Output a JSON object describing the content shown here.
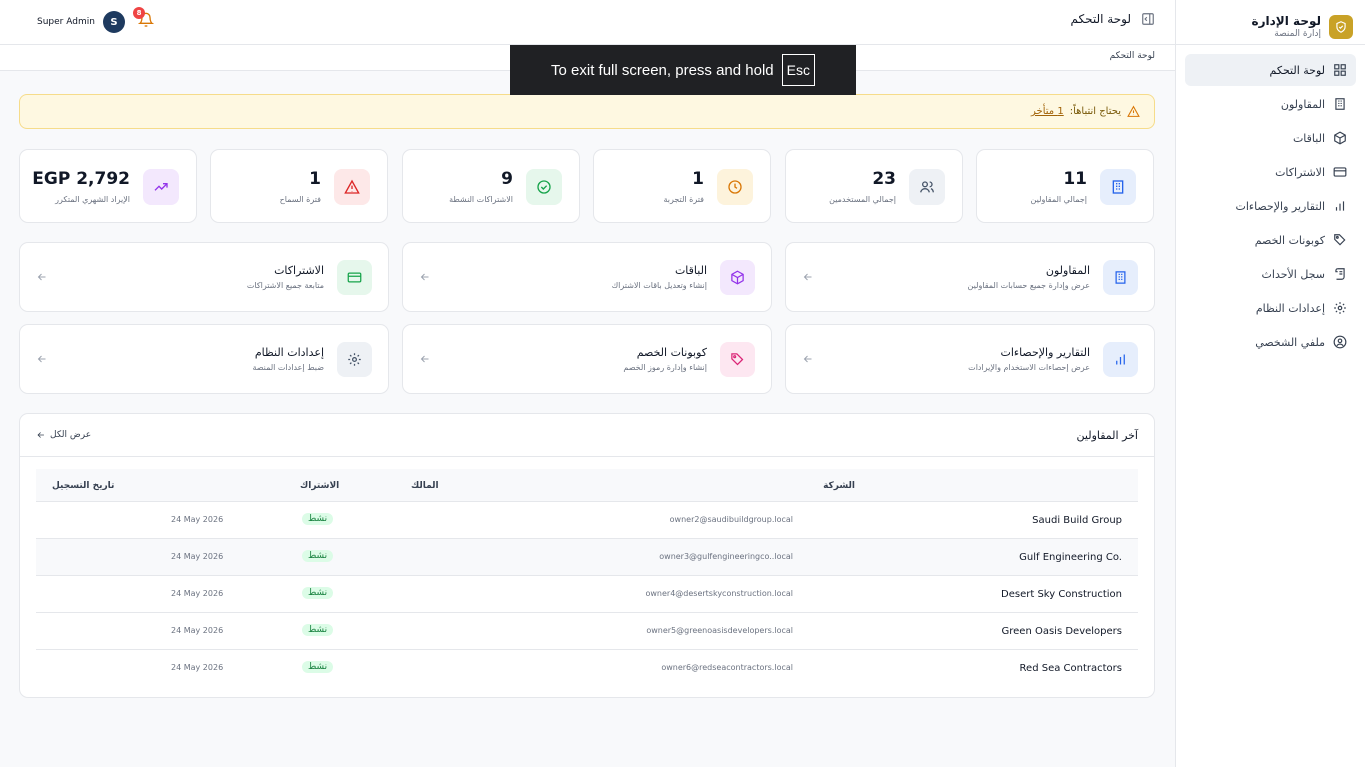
{
  "sidebar": {
    "title": "لوحة الإدارة",
    "subtitle": "إدارة المنصة",
    "items": [
      {
        "label": "لوحة التحكم",
        "icon": "dashboard-icon",
        "active": true
      },
      {
        "label": "المقاولون",
        "icon": "building-icon"
      },
      {
        "label": "الباقات",
        "icon": "package-icon"
      },
      {
        "label": "الاشتراكات",
        "icon": "credit-card-icon"
      },
      {
        "label": "التقارير والإحصاءات",
        "icon": "bar-chart-icon"
      },
      {
        "label": "كوبونات الخصم",
        "icon": "tag-icon"
      },
      {
        "label": "سجل الأحداث",
        "icon": "scroll-icon"
      },
      {
        "label": "إعدادات النظام",
        "icon": "gear-icon"
      },
      {
        "label": "ملفي الشخصي",
        "icon": "user-circle-icon"
      }
    ]
  },
  "topbar": {
    "title": "لوحة التحكم",
    "user_name": "Super Admin",
    "avatar_letter": "S",
    "notification_count": "8"
  },
  "breadcrumb": "لوحة التحكم",
  "fullscreen_toast": {
    "text": "To exit full screen, press and hold",
    "key": "Esc"
  },
  "alert": {
    "text": "يحتاج انتباهاً:",
    "link": "1 متأخر"
  },
  "stats": [
    {
      "value": "11",
      "label": "إجمالي المقاولين",
      "icon": "building-icon",
      "color": "#2563eb"
    },
    {
      "value": "23",
      "label": "إجمالي المستخدمين",
      "icon": "users-icon",
      "color": "#475569"
    },
    {
      "value": "1",
      "label": "فترة التجربة",
      "icon": "clock-icon",
      "color": "#d97706"
    },
    {
      "value": "9",
      "label": "الاشتراكات النشطة",
      "icon": "check-circle-icon",
      "color": "#16a34a"
    },
    {
      "value": "1",
      "label": "فترة السماح",
      "icon": "warning-icon",
      "color": "#dc2626"
    },
    {
      "value": "EGP 2,792",
      "label": "الإيراد الشهري المتكرر",
      "icon": "trending-up-icon",
      "color": "#9333ea"
    }
  ],
  "quick_links": [
    {
      "title": "المقاولون",
      "sub": "عرض وإدارة جميع حسابات المقاولين",
      "icon": "building-icon",
      "color": "#2563eb"
    },
    {
      "title": "الباقات",
      "sub": "إنشاء وتعديل باقات الاشتراك",
      "icon": "package-icon",
      "color": "#9333ea"
    },
    {
      "title": "الاشتراكات",
      "sub": "متابعة جميع الاشتراكات",
      "icon": "credit-card-icon",
      "color": "#16a34a"
    },
    {
      "title": "التقارير والإحصاءات",
      "sub": "عرض إحصاءات الاستخدام والإيرادات",
      "icon": "bar-chart-icon",
      "color": "#2563eb"
    },
    {
      "title": "كوبونات الخصم",
      "sub": "إنشاء وإدارة رموز الخصم",
      "icon": "tag-icon",
      "color": "#db2777"
    },
    {
      "title": "إعدادات النظام",
      "sub": "ضبط إعدادات المنصة",
      "icon": "gear-icon",
      "color": "#475569"
    }
  ],
  "latest": {
    "title": "آخر المقاولين",
    "view_all": "عرض الكل",
    "columns": [
      "الشركة",
      "المالك",
      "الاشتراك",
      "تاريخ التسجيل"
    ],
    "rows": [
      {
        "company": "Saudi Build Group",
        "email": "owner2@saudibuildgroup.local",
        "status": "نشط",
        "date": "24 May 2026"
      },
      {
        "company": "Gulf Engineering Co.",
        "email": "owner3@gulfengineeringco..local",
        "status": "نشط",
        "date": "24 May 2026"
      },
      {
        "company": "Desert Sky Construction",
        "email": "owner4@desertskyconstruction.local",
        "status": "نشط",
        "date": "24 May 2026"
      },
      {
        "company": "Green Oasis Developers",
        "email": "owner5@greenoasisdevelopers.local",
        "status": "نشط",
        "date": "24 May 2026"
      },
      {
        "company": "Red Sea Contractors",
        "email": "owner6@redseacontractors.local",
        "status": "نشط",
        "date": "24 May 2026"
      }
    ]
  }
}
